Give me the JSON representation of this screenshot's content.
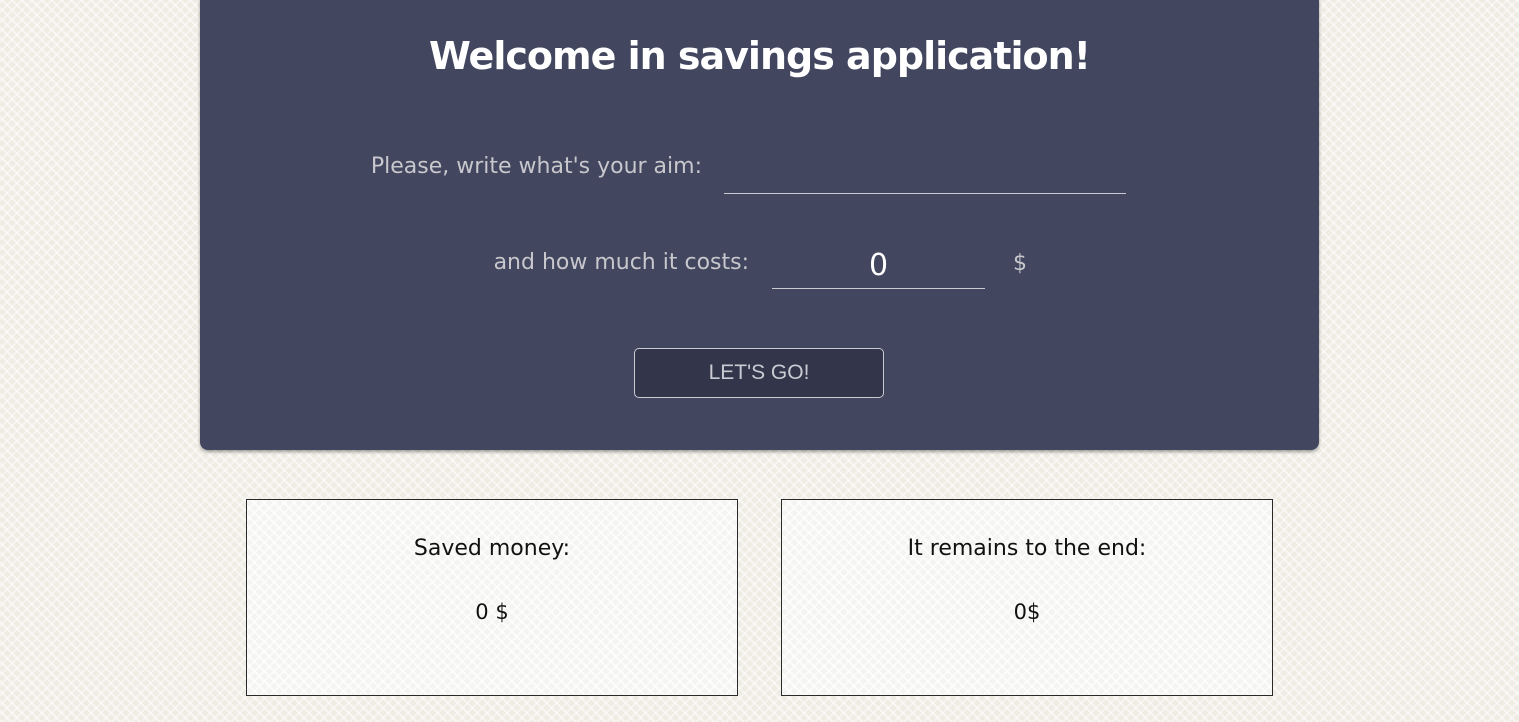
{
  "header": {
    "title": "Welcome in savings application!"
  },
  "form": {
    "aim_label": "Please, write what's your aim:",
    "aim_value": "",
    "cost_label": "and how much it costs:",
    "cost_value": "0",
    "currency": "$",
    "submit_label": "LET'S GO!"
  },
  "summary": {
    "saved_title": "Saved money:",
    "saved_value": "0 $",
    "remaining_title": "It remains to the end:",
    "remaining_value": "0$"
  },
  "colors": {
    "panel": "#42465f",
    "button": "#33364b",
    "page_background": "#efece3"
  }
}
